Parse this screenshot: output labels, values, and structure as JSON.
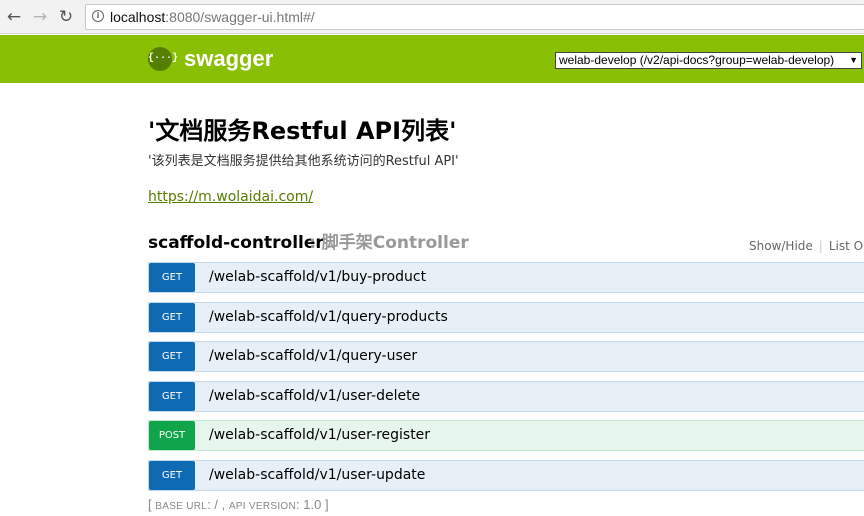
{
  "browser": {
    "url_host": "localhost",
    "url_rest": ":8080/swagger-ui.html#/"
  },
  "header": {
    "logo_symbol": "{···}",
    "logo_text": "swagger",
    "spec_selected": "welab-develop (/v2/api-docs?group=welab-develop)"
  },
  "info": {
    "title": "'文档服务Restful API列表'",
    "description": "'该列表是文档服务提供给其他系统访问的Restful API'",
    "link": "https://m.wolaidai.com/"
  },
  "controller": {
    "name": "scaffold-controller",
    "description": ": 脚手架Controller",
    "show_hide": "Show/Hide",
    "list_ops": "List Op"
  },
  "operations": [
    {
      "method": "GET",
      "path": "/welab-scaffold/v1/buy-product"
    },
    {
      "method": "GET",
      "path": "/welab-scaffold/v1/query-products"
    },
    {
      "method": "GET",
      "path": "/welab-scaffold/v1/query-user"
    },
    {
      "method": "GET",
      "path": "/welab-scaffold/v1/user-delete"
    },
    {
      "method": "POST",
      "path": "/welab-scaffold/v1/user-register"
    },
    {
      "method": "GET",
      "path": "/welab-scaffold/v1/user-update"
    }
  ],
  "footer": {
    "open": "[",
    "base_url_label": "BASE URL",
    "base_url_value": ": / ,",
    "api_version_label": "API VERSION",
    "api_version_value": ": 1.0",
    "close": "]"
  },
  "colors": {
    "header_bg": "#89bf04",
    "get": "#0f6ab4",
    "post": "#10a54a",
    "link": "#547f00"
  }
}
